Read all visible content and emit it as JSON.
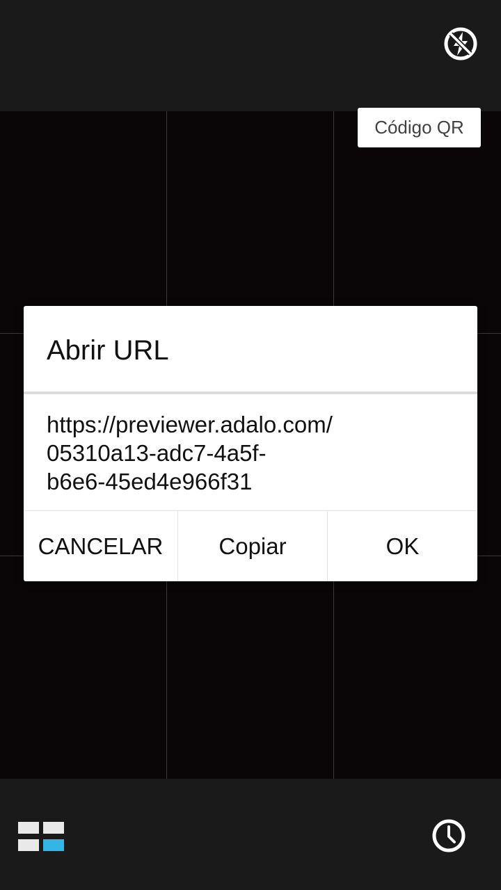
{
  "toolbar": {
    "flash_icon": "flash-off-icon",
    "mode_label": "Código QR"
  },
  "bottom_bar": {
    "menu_icon": "app-grid-icon",
    "history_icon": "history-clock-icon",
    "colors": {
      "tile": "#e9e9e9",
      "tile_accent": "#33b5e5"
    }
  },
  "dialog": {
    "title": "Abrir URL",
    "message_lines": [
      "https://previewer.adalo.com/",
      "05310a13-adc7-4a5f-",
      "b6e6-45ed4e966f31"
    ],
    "buttons": {
      "cancel": "CANCELAR",
      "copy": "Copiar",
      "ok": "OK"
    }
  },
  "colors": {
    "bar_background": "#1a1a1a",
    "viewfinder_background": "#0a0607",
    "dialog_background": "#ffffff",
    "text": "#111111"
  }
}
